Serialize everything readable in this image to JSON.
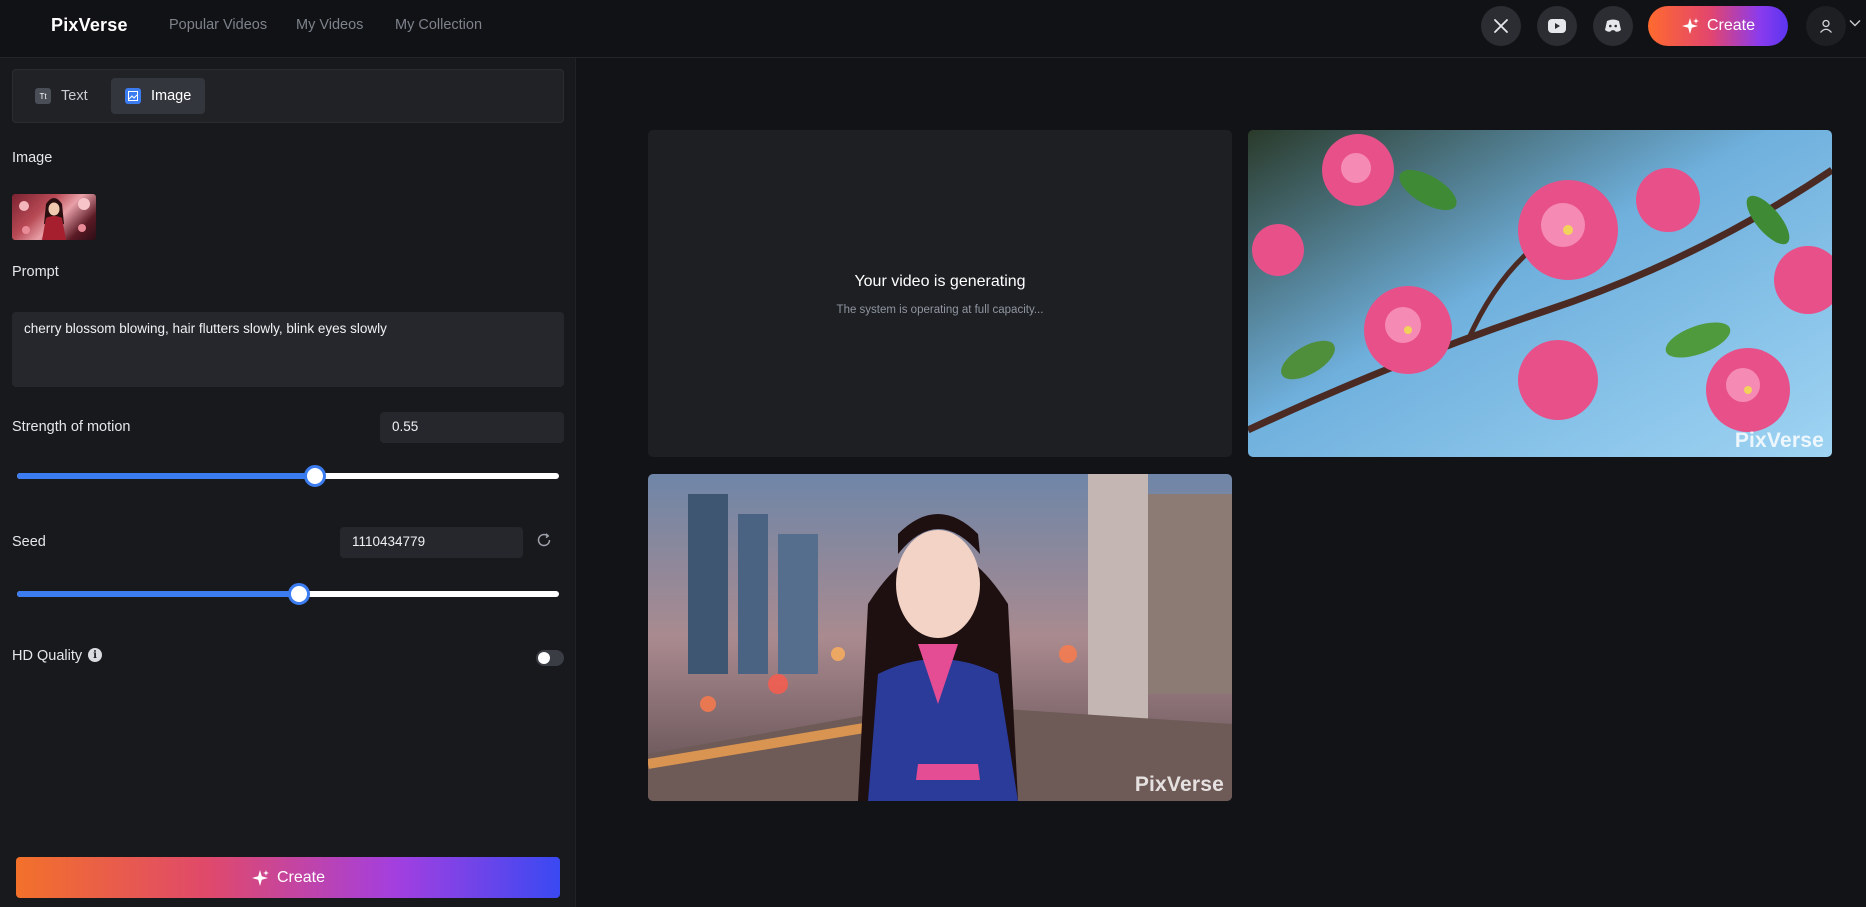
{
  "header": {
    "logo": "PixVerse",
    "nav": [
      {
        "label": "Popular Videos"
      },
      {
        "label": "My Videos"
      },
      {
        "label": "My Collection"
      }
    ],
    "social": [
      "x-icon",
      "youtube-icon",
      "discord-icon"
    ],
    "create_label": "Create"
  },
  "sidebar": {
    "tabs": [
      {
        "label": "Text",
        "icon": "text-icon",
        "active": false
      },
      {
        "label": "Image",
        "icon": "image-icon",
        "active": true
      }
    ],
    "image_label": "Image",
    "prompt_label": "Prompt",
    "prompt_value": "cherry blossom blowing, hair flutters slowly, blink eyes slowly",
    "motion_label": "Strength of motion",
    "motion_value": "0.55",
    "motion_slider_fraction": 0.55,
    "seed_label": "Seed",
    "seed_value": "1110434779",
    "seed_slider_fraction": 0.52,
    "hd_label": "HD Quality",
    "hd_enabled": false,
    "create_label": "Create"
  },
  "gallery": {
    "generating_title": "Your video is generating",
    "generating_subtitle": "The system is operating at full capacity...",
    "watermark": "PixVerse"
  },
  "colors": {
    "accent_blue": "#3b7cf0",
    "gradient_start": "#f2712a",
    "gradient_end": "#3a49f2"
  }
}
